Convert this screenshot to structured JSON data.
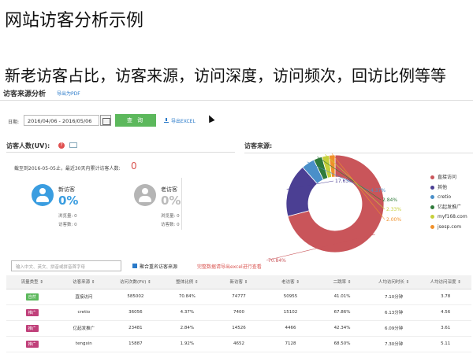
{
  "slide": {
    "title": "网站访客分析示例",
    "subtitle": "新老访客占比，访客来源，访问深度，访问频次，回访比例等等"
  },
  "panel": {
    "title": "访客来源分析",
    "export_pdf": "导出为PDF",
    "date_label": "日期:",
    "date_range": "2016/04/06 - 2016/05/06",
    "query_label": "查 询",
    "export_excel": "导出EXCEL"
  },
  "visitors": {
    "title": "访客人数(UV):",
    "help": "?",
    "notice": "截至到2016-05-05止，最近30天内累计访客人数:",
    "total": "0",
    "new": {
      "label": "新访客",
      "pct": "0%",
      "views": "浏览量: 0",
      "count": "访客数: 0"
    },
    "old": {
      "label": "老访客",
      "pct": "0%",
      "views": "浏览量: 0",
      "count": "访客数: 0"
    }
  },
  "source": {
    "title": "访客来源:"
  },
  "chart_data": {
    "type": "pie",
    "title": "访客来源:",
    "categories": [
      "直接访问",
      "其他",
      "cretio",
      "亿起发推广",
      "myf168.com",
      "jsesp.com"
    ],
    "values": [
      70.84,
      17.63,
      4.37,
      2.84,
      2.33,
      2.0
    ],
    "labels": [
      "70.84%",
      "17.63%",
      "4.37%",
      "2.84%",
      "2.33%",
      "2.00%"
    ],
    "colors": [
      "#c9555a",
      "#4b3f93",
      "#4a8fc9",
      "#2f7a3a",
      "#c6cf3a",
      "#f0902a"
    ],
    "legend_position": "right"
  },
  "filter": {
    "placeholder": "输入中文、英文、拼音或拼音首字母",
    "merge_label": "聚合重名访客来源",
    "excel_hint": "完整数据请导出excel进行查看"
  },
  "table": {
    "headers": [
      "流量类型 ⇕",
      "访客来源 ⇕",
      "访问次数(PV) ⇕",
      "整体比例 ⇕",
      "新访客 ⇕",
      "老访客 ⇕",
      "二跳率 ⇕",
      "人均访问时长 ⇕",
      "人均访问深度 ⇕"
    ],
    "rows": [
      {
        "type": "自然",
        "tag": "green",
        "cells": [
          "直接访问",
          "585002",
          "70.84%",
          "74777",
          "50955",
          "41.01%",
          "7.10分钟",
          "3.78"
        ]
      },
      {
        "type": "推广",
        "tag": "pink",
        "cells": [
          "cretio",
          "36056",
          "4.37%",
          "7400",
          "15102",
          "67.86%",
          "6.13分钟",
          "4.56"
        ]
      },
      {
        "type": "推广",
        "tag": "pink",
        "cells": [
          "亿起发推广",
          "23481",
          "2.84%",
          "14526",
          "4466",
          "42.34%",
          "6.09分钟",
          "3.61"
        ]
      },
      {
        "type": "推广",
        "tag": "pink",
        "cells": [
          "tengxin",
          "15887",
          "1.92%",
          "4652",
          "7128",
          "68.50%",
          "7.30分钟",
          "5.11"
        ]
      }
    ]
  }
}
